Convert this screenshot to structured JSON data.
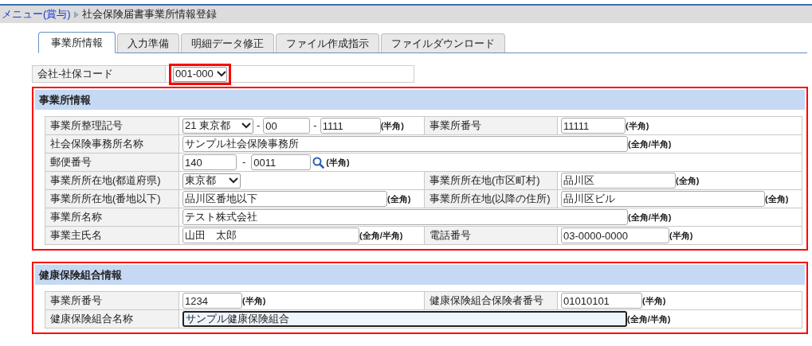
{
  "breadcrumb": {
    "link": "メニュー(賞与)",
    "current": "社会保険届書事業所情報登録"
  },
  "tabs": [
    {
      "label": "事業所情報",
      "selected": true
    },
    {
      "label": "入力準備",
      "selected": false
    },
    {
      "label": "明細データ修正",
      "selected": false
    },
    {
      "label": "ファイル作成指示",
      "selected": false
    },
    {
      "label": "ファイルダウンロード",
      "selected": false
    }
  ],
  "company_code": {
    "label": "会社-社保コード",
    "value": "001-000",
    "highlighted": true
  },
  "sections": [
    {
      "title": "事業所情報",
      "highlighted": true,
      "rows": [
        [
          {
            "label": "事業所整理記号",
            "parts": [
              {
                "kind": "select",
                "value": "21 東京都"
              },
              {
                "kind": "sep",
                "text": "-"
              },
              {
                "kind": "input",
                "value": "00"
              },
              {
                "kind": "sep",
                "text": "-"
              },
              {
                "kind": "input",
                "value": "1111"
              },
              {
                "kind": "note",
                "text": "(半角)"
              }
            ]
          },
          {
            "label": "事業所番号",
            "parts": [
              {
                "kind": "input",
                "value": "11111"
              },
              {
                "kind": "note",
                "text": "(半角)"
              }
            ]
          }
        ],
        [
          {
            "label": "社会保険事務所名称",
            "parts": [
              {
                "kind": "input",
                "value": "サンプル社会保険事務所"
              },
              {
                "kind": "note",
                "text": "(全角/半角)"
              }
            ]
          }
        ],
        [
          {
            "label": "郵便番号",
            "parts": [
              {
                "kind": "input",
                "value": "140"
              },
              {
                "kind": "sep",
                "text": "-"
              },
              {
                "kind": "input",
                "value": "0011"
              },
              {
                "kind": "search"
              },
              {
                "kind": "note",
                "text": "(半角)"
              }
            ]
          }
        ],
        [
          {
            "label": "事業所所在地(都道府県)",
            "parts": [
              {
                "kind": "select",
                "value": "東京都"
              }
            ]
          },
          {
            "label": "事業所所在地(市区町村)",
            "parts": [
              {
                "kind": "input",
                "value": "品川区"
              },
              {
                "kind": "note",
                "text": "(全角)"
              }
            ]
          }
        ],
        [
          {
            "label": "事業所所在地(番地以下)",
            "parts": [
              {
                "kind": "input",
                "value": "品川区番地以下"
              },
              {
                "kind": "note",
                "text": "(全角)"
              }
            ]
          },
          {
            "label": "事業所所在地(以降の住所)",
            "parts": [
              {
                "kind": "input",
                "value": "品川区ビル"
              },
              {
                "kind": "note",
                "text": "(全角)"
              }
            ]
          }
        ],
        [
          {
            "label": "事業所名称",
            "parts": [
              {
                "kind": "input",
                "value": "テスト株式会社"
              },
              {
                "kind": "note",
                "text": "(全角/半角)"
              }
            ]
          }
        ],
        [
          {
            "label": "事業主氏名",
            "parts": [
              {
                "kind": "input",
                "value": "山田　太郎"
              },
              {
                "kind": "note",
                "text": "(全角/半角)"
              }
            ]
          },
          {
            "label": "電話番号",
            "parts": [
              {
                "kind": "input",
                "value": "03-0000-0000"
              },
              {
                "kind": "note",
                "text": "(半角)"
              }
            ]
          }
        ]
      ]
    },
    {
      "title": "健康保険組合情報",
      "highlighted": true,
      "rows": [
        [
          {
            "label": "事業所番号",
            "parts": [
              {
                "kind": "input",
                "value": "1234"
              },
              {
                "kind": "note",
                "text": "(半角)"
              }
            ]
          },
          {
            "label": "健康保険組合保険者番号",
            "parts": [
              {
                "kind": "input",
                "value": "01010101"
              },
              {
                "kind": "note",
                "text": "(半角)"
              }
            ]
          }
        ],
        [
          {
            "label": "健康保険組合名称",
            "parts": [
              {
                "kind": "input",
                "value": "サンプル健康保険組合",
                "focused": true
              },
              {
                "kind": "note",
                "text": "(全角/半角)"
              }
            ]
          }
        ]
      ]
    }
  ]
}
